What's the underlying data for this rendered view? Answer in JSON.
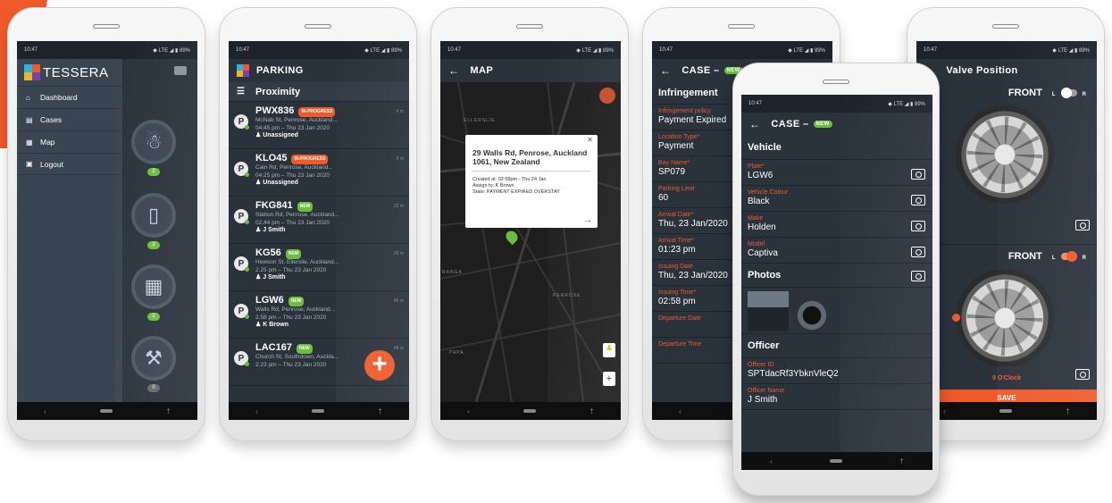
{
  "status_time": "10:47",
  "status_right": "◆ LTE ◢ ▮ 89%",
  "nav": {
    "back": "‹",
    "up": "†"
  },
  "phone1": {
    "app_name": "TESSERA",
    "menu": [
      {
        "icon": "⌂",
        "label": "Dashboard"
      },
      {
        "icon": "▤",
        "label": "Cases"
      },
      {
        "icon": "▦",
        "label": "Map"
      },
      {
        "icon": "▣",
        "label": "Logout"
      }
    ],
    "counts": [
      "2",
      "2",
      "2",
      "0"
    ],
    "icons": [
      "dog-icon",
      "trash-icon",
      "building-icon",
      "gavel-icon"
    ]
  },
  "phone2": {
    "title": "PARKING",
    "filter": "Proximity",
    "items": [
      {
        "plate": "PWX836",
        "tag": "IN-PROGRESS",
        "tag_type": "prog",
        "address": "McNab St, Penrose, Auckland...",
        "time": "04:45 pm – Thu 23 Jan 2020",
        "user": "Unassigned",
        "dist": "6 m"
      },
      {
        "plate": "KLO45",
        "tag": "IN-PROGRESS",
        "tag_type": "prog",
        "address": "Cain Rd, Penrose, Auckland...",
        "time": "04:25 pm – Thu 23 Jan 2020",
        "user": "Unassigned",
        "dist": "8 m"
      },
      {
        "plate": "FKG841",
        "tag": "NEW",
        "tag_type": "new",
        "address": "Station Rd, Penrose, Auckland...",
        "time": "02.44 pm – Thu 23 Jan 2020",
        "user": "J Smith",
        "dist": "22 m"
      },
      {
        "plate": "KG56",
        "tag": "NEW",
        "tag_type": "new",
        "address": "Hewson St, Ellerslie, Auckland...",
        "time": "2.25 pm – Thu 23 Jan 2020",
        "user": "J Smith",
        "dist": "26 m"
      },
      {
        "plate": "LGW6",
        "tag": "NEW",
        "tag_type": "new",
        "address": "Walls Rd, Penrose, Auckland...",
        "time": "2.58 pm – Thu 23 Jan 2020",
        "user": "K Brown",
        "dist": "46 m"
      },
      {
        "plate": "LAC167",
        "tag": "NEW",
        "tag_type": "new",
        "address": "Church St, Southdown, Auckla...",
        "time": "2.23 pm – Thu 23 Jan 2020",
        "user": "",
        "dist": "48 m"
      }
    ],
    "fab": "+"
  },
  "phone3": {
    "title": "MAP",
    "map_labels": [
      "ELLERSLIE",
      "PENROSE",
      "PAPA",
      "RANGA"
    ],
    "popup": {
      "title": "29 Walls Rd, Penrose, Auckland 1061, New Zealand",
      "created": "Created at:  02:58pm - Thu 24 Jan",
      "assign": "Assign to:  K Brown",
      "state": "State:  PAYMENT EXPIRED OVERSTAY",
      "close": "✕",
      "arrow": "→"
    },
    "zoom": "+"
  },
  "phone4": {
    "title": "CASE –",
    "tag": "NEW",
    "section": "Infringement",
    "fields": [
      {
        "label": "Infringement policy",
        "value": "Payment Expired"
      },
      {
        "label": "Location Type*",
        "value": "Payment"
      },
      {
        "label": "Bay Name*",
        "value": "SP079"
      },
      {
        "label": "Parking Limit",
        "value": "60"
      },
      {
        "label": "Arrival Date*",
        "value": "Thu, 23 Jan/2020"
      },
      {
        "label": "Arrival Time*",
        "value": "01:23 pm"
      },
      {
        "label": "Issuing Date",
        "value": "Thu, 23 Jan/2020"
      },
      {
        "label": "Issuing Time*",
        "value": "02:58 pm"
      },
      {
        "label": "Departure Date",
        "value": ""
      },
      {
        "label": "Departure Time",
        "value": ""
      }
    ]
  },
  "phone5": {
    "title": "CASE –",
    "tag": "NEW",
    "vehicle_section": "Vehicle",
    "fields": [
      {
        "label": "Plate*",
        "value": "LGW6"
      },
      {
        "label": "Vehicle Colour",
        "value": "Black"
      },
      {
        "label": "Make",
        "value": "Holden"
      },
      {
        "label": "Model",
        "value": "Captiva"
      }
    ],
    "photos_section": "Photos",
    "officer_section": "Officer",
    "officer_fields": [
      {
        "label": "Officer ID",
        "value": "SPTdacRf3YbknVleQ2"
      },
      {
        "label": "Officer Name",
        "value": "J Smith"
      }
    ]
  },
  "phone6": {
    "title": "Valve Position",
    "front1": "FRONT",
    "front2": "FRONT",
    "l": "L",
    "r": "R",
    "clock": "9 O'Clock",
    "save": "SAVE"
  }
}
